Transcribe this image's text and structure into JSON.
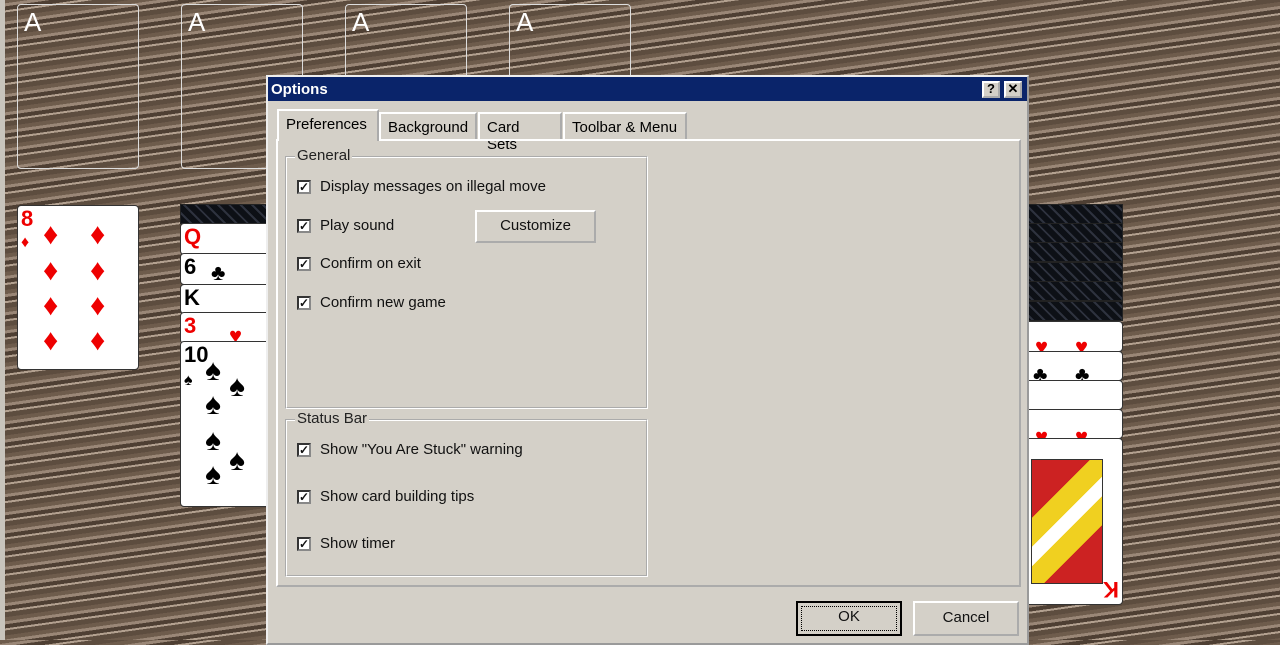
{
  "game": {
    "foundations": [
      "A",
      "A",
      "A",
      "A"
    ],
    "cards": [
      {
        "rank": "8",
        "suit": "♦"
      },
      {
        "rank": "Q",
        "suit": "♦"
      },
      {
        "rank": "6",
        "suit": "♣"
      },
      {
        "rank": "K",
        "suit": "♠"
      },
      {
        "rank": "3",
        "suit": "♥"
      },
      {
        "rank": "10",
        "suit": "♠"
      },
      {
        "rank": "K",
        "suit": "♥"
      }
    ]
  },
  "dialog": {
    "title": "Options",
    "help": "?",
    "close": "✕",
    "tabs": [
      "Preferences",
      "Background",
      "Card Sets",
      "Toolbar & Menu"
    ],
    "general": {
      "label": "General",
      "items": [
        {
          "label": "Display messages on illegal move",
          "checked": true
        },
        {
          "label": "Play sound",
          "checked": true
        },
        {
          "label": "Confirm on exit",
          "checked": true
        },
        {
          "label": "Confirm new game",
          "checked": true
        }
      ],
      "customize": "Customize"
    },
    "statusbar": {
      "label": "Status Bar",
      "items": [
        {
          "label": "Show \"You Are Stuck\" warning",
          "checked": true
        },
        {
          "label": "Show card building tips",
          "checked": true
        },
        {
          "label": "Show timer",
          "checked": true
        }
      ]
    },
    "ok": "OK",
    "cancel": "Cancel"
  },
  "colors": {
    "titlebar": "#0a246a",
    "dialog": "#d4d0c8",
    "card_red": "#e00000"
  }
}
